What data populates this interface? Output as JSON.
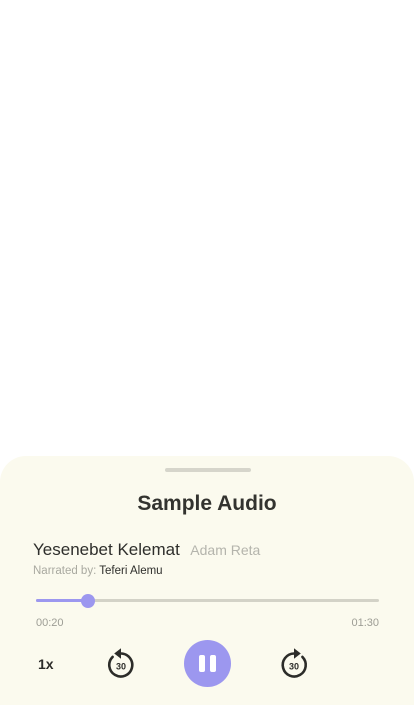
{
  "player": {
    "title": "Sample Audio",
    "track_title": "Yesenebet Kelemat",
    "author": "Adam Reta",
    "narrator_label": "Narrated by:",
    "narrator_name": "Teferi Alemu",
    "elapsed": "00:20",
    "total": "01:30",
    "progress_fraction": 0.152,
    "speed_label": "1x",
    "rewind_label": "30",
    "forward_label": "30",
    "state": "playing"
  },
  "icons": {
    "rewind": "rewind-30-icon",
    "forward": "forward-30-icon",
    "pause": "pause-icon"
  },
  "colors": {
    "accent": "#9c97ef",
    "sheet_background": "#fbfaee",
    "text_primary": "#2e2e2b",
    "text_muted": "#a9a9a0"
  }
}
